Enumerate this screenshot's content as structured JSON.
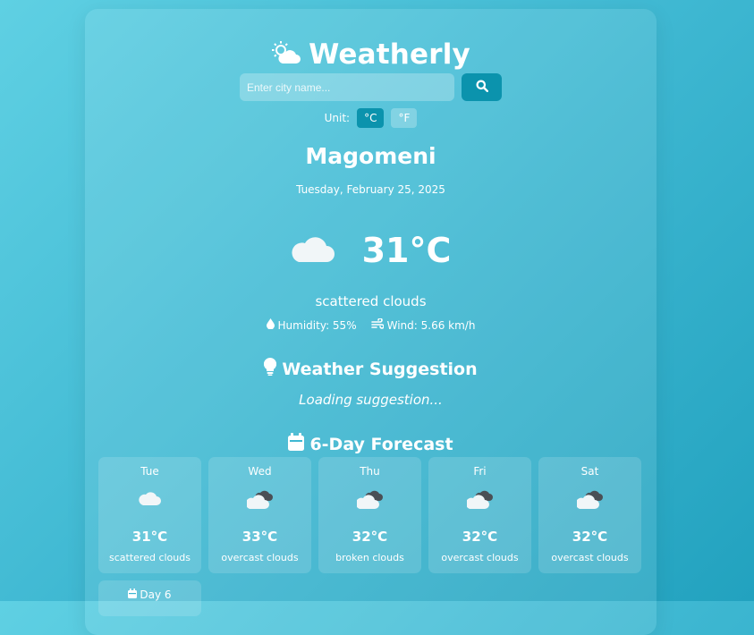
{
  "app": {
    "title": "Weatherly"
  },
  "search": {
    "placeholder": "Enter city name..."
  },
  "units": {
    "label": "Unit:",
    "celsius": "°C",
    "fahrenheit": "°F",
    "selected": "°C"
  },
  "current": {
    "city": "Magomeni",
    "date": "Tuesday, February 25, 2025",
    "temperature": "31°C",
    "description": "scattered clouds",
    "humidity": "Humidity: 55%",
    "wind": "Wind: 5.66 km/h",
    "icon": "cloud-icon"
  },
  "suggestion": {
    "title": "Weather Suggestion",
    "text": "Loading suggestion..."
  },
  "forecast": {
    "title": "6-Day Forecast",
    "days": [
      {
        "day": "Tue",
        "temp": "31°C",
        "desc": "scattered clouds",
        "icon": "cloud-icon"
      },
      {
        "day": "Wed",
        "temp": "33°C",
        "desc": "overcast clouds",
        "icon": "overcast-cloud-icon"
      },
      {
        "day": "Thu",
        "temp": "32°C",
        "desc": "broken clouds",
        "icon": "overcast-cloud-icon"
      },
      {
        "day": "Fri",
        "temp": "32°C",
        "desc": "overcast clouds",
        "icon": "overcast-cloud-icon"
      },
      {
        "day": "Sat",
        "temp": "32°C",
        "desc": "overcast clouds",
        "icon": "overcast-cloud-icon"
      },
      {
        "day": "Day 6",
        "icon": "calendar-icon"
      }
    ]
  },
  "colors": {
    "accent": "#0b93ad",
    "text": "#ffffff"
  }
}
